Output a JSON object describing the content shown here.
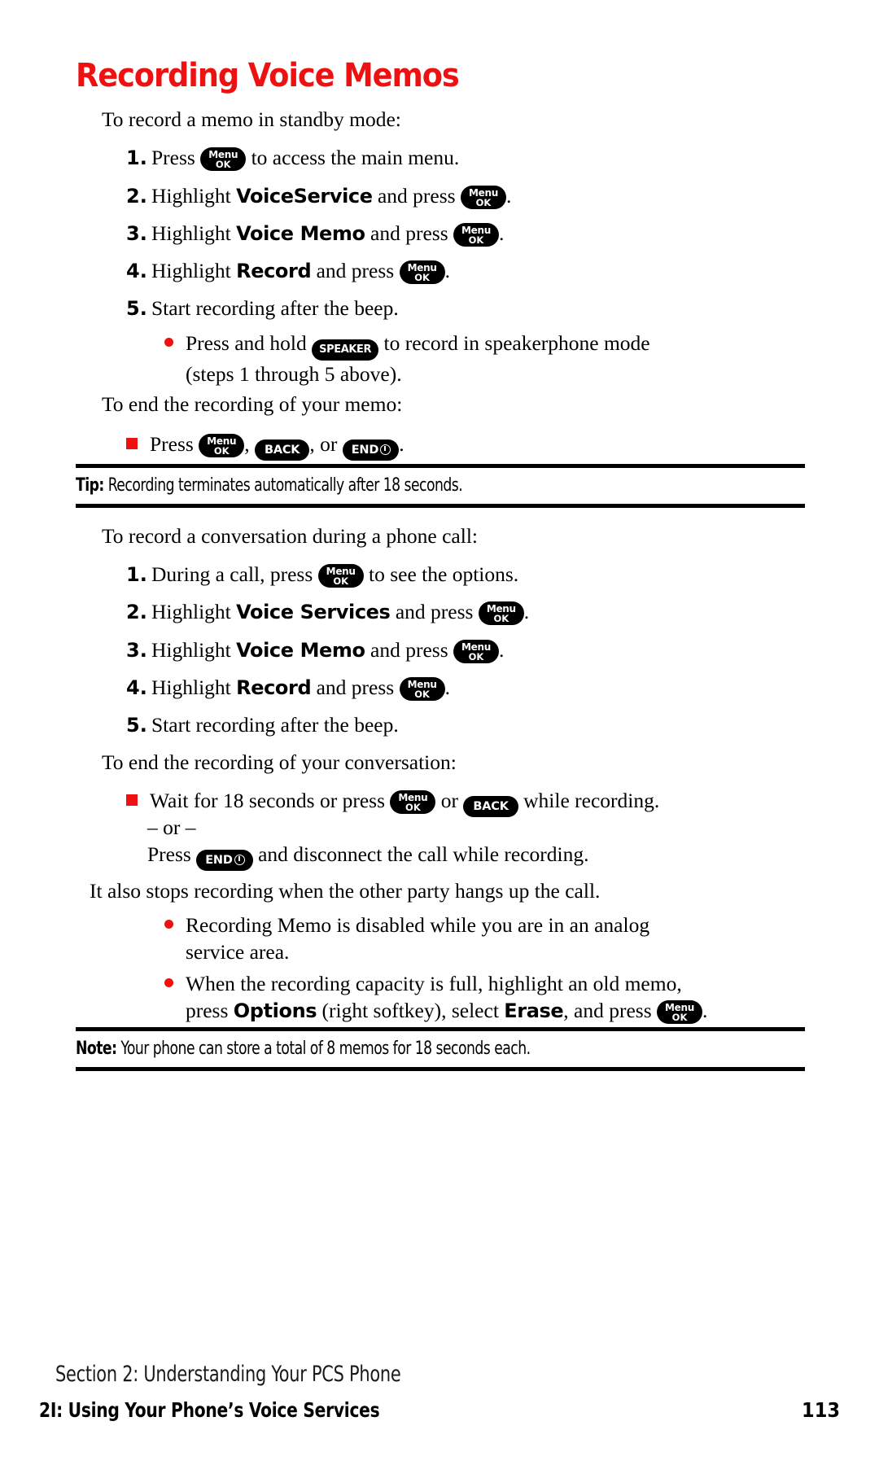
{
  "title": "Recording Voice Memos",
  "title_color": "#ee1111",
  "accent_color": "#ee1111",
  "keys": {
    "menu": "Menu",
    "ok": "OK",
    "back": "BACK",
    "speaker": "SPEAKER",
    "end": "END"
  },
  "section_a": {
    "lead": "To record a memo in standby mode:",
    "steps": [
      {
        "num": "1.",
        "pre": "Press ",
        "key": "menuok",
        "post": " to access the main menu."
      },
      {
        "num": "2.",
        "pre": "Highlight ",
        "term": "VoiceService",
        "mid": " and press ",
        "key": "menuok",
        "post": "."
      },
      {
        "num": "3.",
        "pre": "Highlight ",
        "term": "Voice Memo",
        "mid": " and press ",
        "key": "menuok",
        "post": "."
      },
      {
        "num": "4.",
        "pre": "Highlight ",
        "term": "Record",
        "mid": " and press ",
        "key": "menuok",
        "post": "."
      },
      {
        "num": "5.",
        "pre": "Start recording after the beep.",
        "key": "",
        "post": ""
      }
    ],
    "bullet": {
      "line1_pre": "Press and hold ",
      "line1_key": "speaker",
      "line1_post": " to record in speakerphone mode",
      "line2": "(steps 1 through 5 above)."
    },
    "end_lead": "To end the recording of your memo:",
    "end_bullet": {
      "pre": "Press ",
      "key1": "menuok",
      "sep1": ", ",
      "key2": "back",
      "sep2": ", or ",
      "key3": "end",
      "post": "."
    }
  },
  "tip": {
    "label": "Tip:",
    "text": " Recording terminates automatically after 18 seconds."
  },
  "section_b": {
    "lead": "To record a conversation during a phone call:",
    "steps": [
      {
        "num": "1.",
        "pre": "During a call, press ",
        "key": "menuok",
        "post": " to see the options."
      },
      {
        "num": "2.",
        "pre": "Highlight ",
        "term": "Voice Services",
        "mid": " and press ",
        "key": "menuok",
        "post": "."
      },
      {
        "num": "3.",
        "pre": "Highlight ",
        "term": "Voice Memo",
        "mid": " and press ",
        "key": "menuok",
        "post": "."
      },
      {
        "num": "4.",
        "pre": "Highlight ",
        "term": "Record",
        "mid": " and press ",
        "key": "menuok",
        "post": "."
      },
      {
        "num": "5.",
        "pre": "Start recording after the beep.",
        "key": "",
        "post": ""
      }
    ],
    "end_lead": "To end the recording of your conversation:",
    "end_bullet": {
      "pre": "Wait for 18 seconds or press ",
      "key1": "menuok",
      "mid": " or ",
      "key2": "back",
      "post": " while recording."
    },
    "or_text": "– or –",
    "alt_line": {
      "pre": "Press ",
      "key": "end",
      "post": " and disconnect the call while recording."
    },
    "note_line": "It also stops recording when the other party hangs up the call.",
    "bullets": [
      {
        "line1": "Recording Memo is disabled while you are in an analog",
        "line2": "service area."
      },
      {
        "line1": "When the recording capacity is full, highlight an old memo,",
        "line2_pre": "press ",
        "line2_term1": "Options",
        "line2_mid": " (right softkey), select ",
        "line2_term2": "Erase",
        "line2_post": ", and press ",
        "line2_key": "menuok",
        "line2_end": "."
      }
    ]
  },
  "note": {
    "label": "Note:",
    "text": " Your phone can store a total of 8 memos for 18 seconds each."
  },
  "footer": {
    "section": "Section 2: Understanding Your PCS Phone",
    "chapter": "2I: Using Your Phone’s Voice Services",
    "page": "113"
  }
}
